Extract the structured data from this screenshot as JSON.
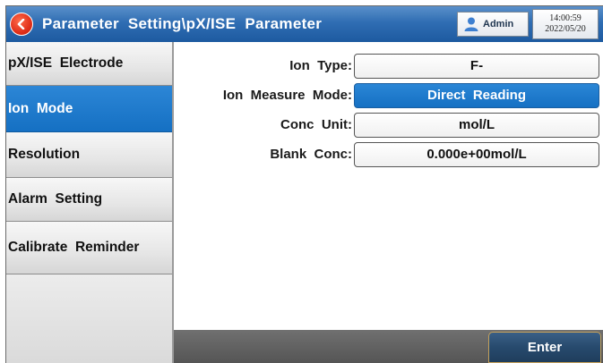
{
  "titlebar": {
    "back_icon": "back-arrow-icon",
    "title": "Parameter  Setting\\pX/ISE  Parameter",
    "user_icon": "user-icon",
    "user_name": "Admin",
    "time": "14:00:59",
    "date": "2022/05/20"
  },
  "sidebar": {
    "items": [
      {
        "label": "pX/ISE  Electrode",
        "active": false
      },
      {
        "label": "Ion  Mode",
        "active": true
      },
      {
        "label": "Resolution",
        "active": false
      },
      {
        "label": "Alarm  Setting",
        "active": false
      },
      {
        "label": "Calibrate  Reminder",
        "active": false
      }
    ]
  },
  "form": {
    "ion_type": {
      "label": "Ion  Type:",
      "value": "F-"
    },
    "measure_mode": {
      "label": "Ion  Measure  Mode:",
      "value": "Direct  Reading"
    },
    "conc_unit": {
      "label": "Conc  Unit:",
      "value": "mol/L"
    },
    "blank_conc": {
      "label": "Blank  Conc:",
      "value": "0.000e+00mol/L"
    }
  },
  "footer": {
    "enter_label": "Enter"
  },
  "colors": {
    "titlebar": "#2f6db3",
    "accent": "#1570c3",
    "back_button": "#e0301b"
  }
}
